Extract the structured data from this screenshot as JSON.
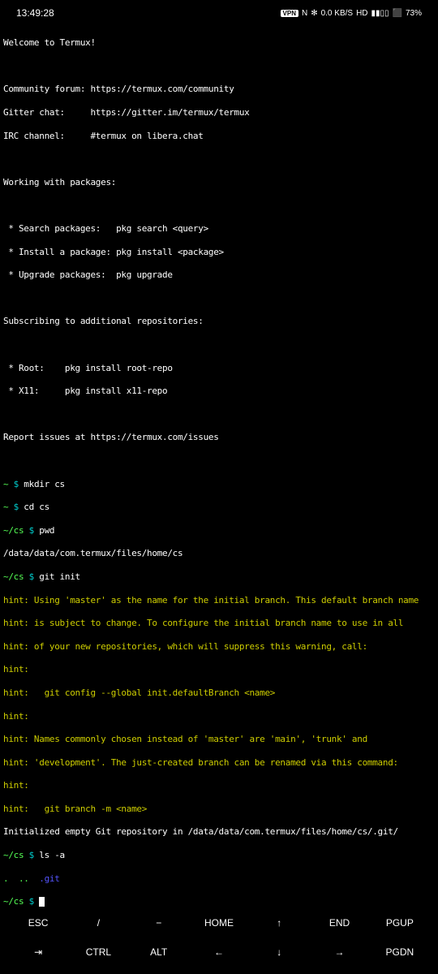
{
  "status": {
    "time": "13:49:28",
    "vpn": "VPN",
    "nfc": "N",
    "bt": "✻",
    "net": "0.0 KB/S",
    "hd": "HD",
    "signal": "▮▮▯▯",
    "battery_icon": "⬛",
    "battery": "73%"
  },
  "welcome": {
    "title": "Welcome to Termux!",
    "forum_label": "Community forum: ",
    "forum_url": "https://termux.com/community",
    "gitter_label": "Gitter chat:     ",
    "gitter_url": "https://gitter.im/termux/termux",
    "irc_label": "IRC channel:     ",
    "irc_val": "#termux on libera.chat",
    "pkg_header": "Working with packages:",
    "pkg_search": " * Search packages:   pkg search <query>",
    "pkg_install": " * Install a package: pkg install <package>",
    "pkg_upgrade": " * Upgrade packages:  pkg upgrade",
    "repo_header": "Subscribing to additional repositories:",
    "repo_root": " * Root:    pkg install root-repo",
    "repo_x11": " * X11:     pkg install x11-repo",
    "issues_label": "Report issues at ",
    "issues_url": "https://termux.com/issues"
  },
  "session": {
    "p1_prompt": "~",
    "p1_dollar": " $ ",
    "p1_cmd": "mkdir cs",
    "p2_prompt": "~",
    "p2_dollar": " $ ",
    "p2_cmd": "cd cs",
    "p3_prompt": "~/cs",
    "p3_dollar": " $ ",
    "p3_cmd": "pwd",
    "p3_out": "/data/data/com.termux/files/home/cs",
    "p4_prompt": "~/cs",
    "p4_dollar": " $ ",
    "p4_cmd": "git init",
    "h1": "hint: Using 'master' as the name for the initial branch. This default branch name",
    "h2": "hint: is subject to change. To configure the initial branch name to use in all",
    "h3": "hint: of your new repositories, which will suppress this warning, call:",
    "h4": "hint:",
    "h5": "hint:   git config --global init.defaultBranch <name>",
    "h6": "hint:",
    "h7": "hint: Names commonly chosen instead of 'master' are 'main', 'trunk' and",
    "h8": "hint: 'development'. The just-created branch can be renamed via this command:",
    "h9": "hint:",
    "h10": "hint:   git branch -m <name>",
    "init_out": "Initialized empty Git repository in /data/data/com.termux/files/home/cs/.git/",
    "p5_prompt": "~/cs",
    "p5_dollar": " $ ",
    "p5_cmd": "ls -a",
    "ls_dots": ".  ..  ",
    "ls_git": ".git",
    "p6_prompt": "~/cs",
    "p6_dollar": " $ "
  },
  "keys": {
    "r1": [
      "ESC",
      "/",
      "−",
      "HOME",
      "↑",
      "END",
      "PGUP"
    ],
    "r2": [
      "⇥",
      "CTRL",
      "ALT",
      "←",
      "↓",
      "→",
      "PGDN"
    ]
  }
}
